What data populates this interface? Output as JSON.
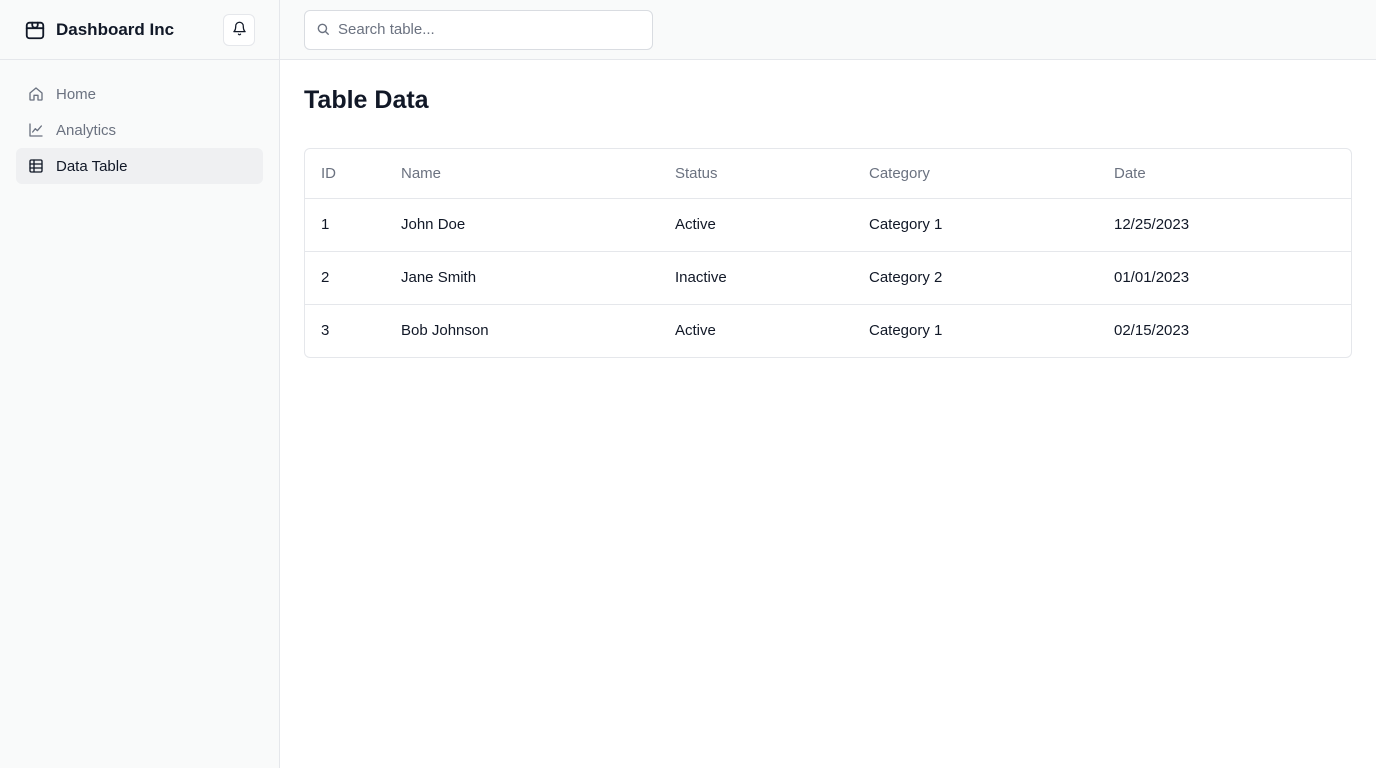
{
  "brand": {
    "name": "Dashboard Inc",
    "logo_icon": "package-icon"
  },
  "header": {
    "notification_icon": "bell-icon"
  },
  "sidebar": {
    "items": [
      {
        "label": "Home",
        "icon": "home-icon",
        "active": false
      },
      {
        "label": "Analytics",
        "icon": "line-chart-icon",
        "active": false
      },
      {
        "label": "Data Table",
        "icon": "table-icon",
        "active": true
      }
    ]
  },
  "search": {
    "placeholder": "Search table...",
    "value": ""
  },
  "main": {
    "title": "Table Data"
  },
  "table": {
    "columns": [
      "ID",
      "Name",
      "Status",
      "Category",
      "Date"
    ],
    "rows": [
      [
        "1",
        "John Doe",
        "Active",
        "Category 1",
        "12/25/2023"
      ],
      [
        "2",
        "Jane Smith",
        "Inactive",
        "Category 2",
        "01/01/2023"
      ],
      [
        "3",
        "Bob Johnson",
        "Active",
        "Category 1",
        "02/15/2023"
      ]
    ]
  },
  "colors": {
    "sidebar_bg": "#f9fafa",
    "active_item_bg": "#eff0f2",
    "border": "#e5e7eb",
    "muted_text": "#6b7280",
    "text": "#111827"
  }
}
